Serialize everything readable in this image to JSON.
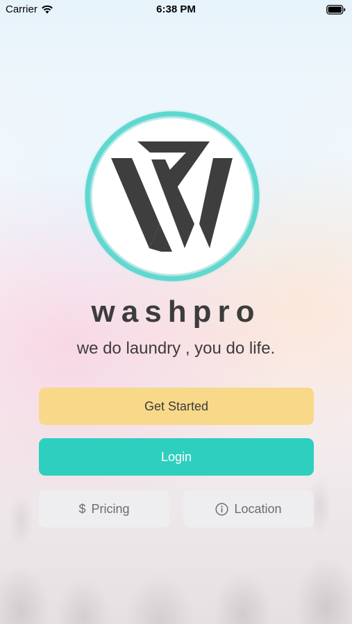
{
  "status_bar": {
    "carrier": "Carrier",
    "time": "6:38 PM"
  },
  "brand": {
    "name": "washpro",
    "tagline": "we do laundry , you do life."
  },
  "buttons": {
    "get_started": "Get Started",
    "login": "Login",
    "pricing": "Pricing",
    "pricing_icon_glyph": "$",
    "location": "Location"
  },
  "colors": {
    "accent_teal": "#2fcfc0",
    "get_started_yellow": "#f8d98a",
    "logo_ring": "#5fd8cf",
    "logo_dark": "#3e3e3e"
  },
  "icons": [
    "wifi-icon",
    "battery-icon",
    "washpro-logo",
    "dollar-icon",
    "info-icon"
  ]
}
